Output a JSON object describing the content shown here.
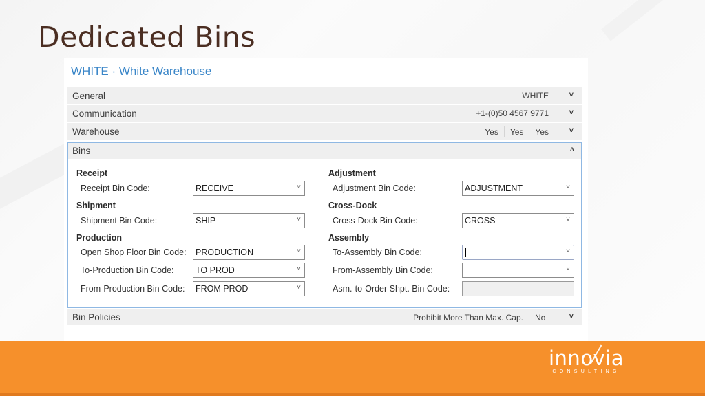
{
  "slide": {
    "title": "Dedicated Bins"
  },
  "window": {
    "title": "WHITE · White Warehouse"
  },
  "fasttabs": [
    {
      "label": "General",
      "summary": [
        "WHITE"
      ],
      "state": "collapsed"
    },
    {
      "label": "Communication",
      "summary": [
        "+1-(0)50 4567 9771"
      ],
      "state": "collapsed"
    },
    {
      "label": "Warehouse",
      "summary": [
        "Yes",
        "Yes",
        "Yes"
      ],
      "state": "collapsed"
    },
    {
      "label": "Bins",
      "summary": [],
      "state": "expanded"
    },
    {
      "label": "Bin Policies",
      "summary": [
        "Prohibit More Than Max. Cap.",
        "No"
      ],
      "state": "collapsed"
    }
  ],
  "bins": {
    "left": [
      {
        "group": "Receipt",
        "fields": [
          {
            "label": "Receipt Bin Code:",
            "value": "RECEIVE",
            "type": "dropdown"
          }
        ]
      },
      {
        "group": "Shipment",
        "fields": [
          {
            "label": "Shipment Bin Code:",
            "value": "SHIP",
            "type": "dropdown"
          }
        ]
      },
      {
        "group": "Production",
        "fields": [
          {
            "label": "Open Shop Floor Bin Code:",
            "value": "PRODUCTION",
            "type": "dropdown"
          },
          {
            "label": "To-Production Bin Code:",
            "value": "TO PROD",
            "type": "dropdown"
          },
          {
            "label": "From-Production Bin Code:",
            "value": "FROM PROD",
            "type": "dropdown"
          }
        ]
      }
    ],
    "right": [
      {
        "group": "Adjustment",
        "fields": [
          {
            "label": "Adjustment Bin Code:",
            "value": "ADJUSTMENT",
            "type": "dropdown"
          }
        ]
      },
      {
        "group": "Cross-Dock",
        "fields": [
          {
            "label": "Cross-Dock Bin Code:",
            "value": "CROSS",
            "type": "dropdown"
          }
        ]
      },
      {
        "group": "Assembly",
        "fields": [
          {
            "label": "To-Assembly Bin Code:",
            "value": "",
            "type": "dropdown",
            "focused": true
          },
          {
            "label": "From-Assembly Bin Code:",
            "value": "",
            "type": "dropdown"
          },
          {
            "label": "Asm.-to-Order Shpt. Bin Code:",
            "value": "",
            "type": "readonly"
          }
        ]
      }
    ]
  },
  "icons": {
    "chevron_down": "⌄",
    "chevron_up": "^",
    "dropdown_arrow": "⌄"
  },
  "branding": {
    "logo_name": "innovia",
    "logo_sub": "CONSULTING",
    "accent_color": "#f6902b",
    "title_color": "#4b2e22",
    "link_color": "#3a86c8"
  }
}
